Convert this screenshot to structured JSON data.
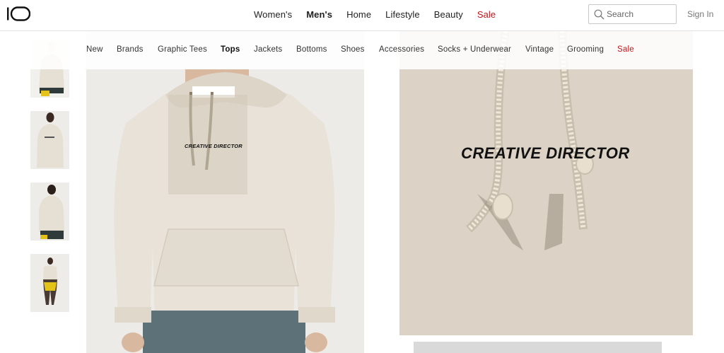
{
  "header": {
    "nav": [
      {
        "label": "Women's"
      },
      {
        "label": "Men's"
      },
      {
        "label": "Home"
      },
      {
        "label": "Lifestyle"
      },
      {
        "label": "Beauty"
      },
      {
        "label": "Sale"
      }
    ],
    "active_nav": "Men's",
    "search_placeholder": "Search",
    "sign_in": "Sign In"
  },
  "subnav": {
    "items": [
      {
        "label": "New"
      },
      {
        "label": "Brands"
      },
      {
        "label": "Graphic Tees"
      },
      {
        "label": "Tops"
      },
      {
        "label": "Jackets"
      },
      {
        "label": "Bottoms"
      },
      {
        "label": "Shoes"
      },
      {
        "label": "Accessories"
      },
      {
        "label": "Socks + Underwear"
      },
      {
        "label": "Vintage"
      },
      {
        "label": "Grooming"
      },
      {
        "label": "Sale"
      }
    ],
    "active": "Tops"
  },
  "product": {
    "graphic_text": "CREATIVE DIRECTOR"
  },
  "colors": {
    "sale": "#c0161d",
    "hoodie": "#e8e2d8",
    "zoom_fabric": "#dcd3c6"
  }
}
